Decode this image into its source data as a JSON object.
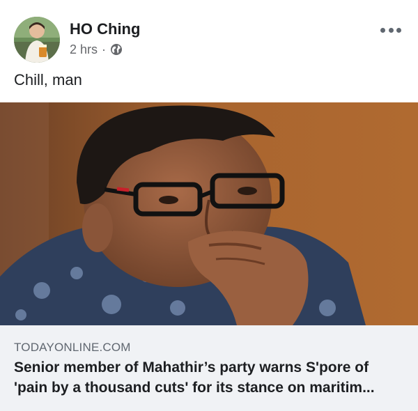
{
  "post": {
    "author": "HO Ching",
    "time": "2 hrs",
    "separator": "·",
    "privacy_icon": "globe-icon",
    "more_icon": "more-options-icon",
    "message": "Chill, man"
  },
  "link": {
    "domain": "TODAYONLINE.COM",
    "headline_line1": "Senior member of Mahathir’s party warns S'pore of",
    "headline_line2": "'pain by a thousand cuts' for its stance on maritim..."
  },
  "colors": {
    "text_primary": "#1c1e21",
    "text_secondary": "#65676b",
    "link_box_bg": "#f0f2f5"
  }
}
